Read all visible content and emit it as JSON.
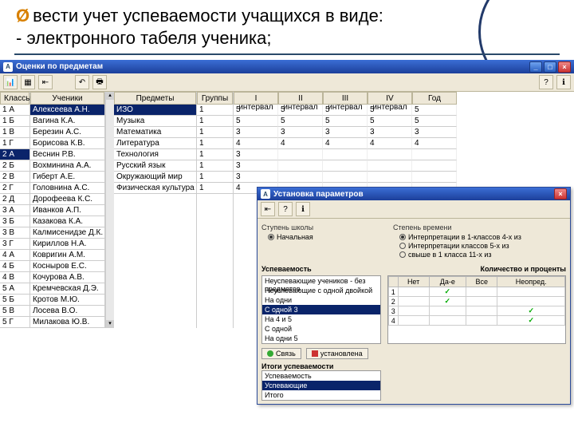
{
  "slide": {
    "line1": "вести учет успеваемости учащихся в виде:",
    "line2": "- электронного табеля ученика;"
  },
  "main_window": {
    "title": "Оценки по предметам",
    "app_icon_letter": "A",
    "toolbar_icons": [
      "chart-icon",
      "grid-icon",
      "exit-icon",
      "",
      "undo-icon",
      "print-icon"
    ],
    "columns": {
      "classes": "Классы",
      "students": "Ученики",
      "subjects": "Предметы",
      "groups": "Группы",
      "interval1": "I интервал",
      "interval2": "II интервал",
      "interval3": "III интервал",
      "interval4": "IV интервал",
      "year": "Год"
    },
    "classes": [
      "1 А",
      "1 Б",
      "1 В",
      "1 Г",
      "2 А",
      "2 Б",
      "2 В",
      "2 Г",
      "2 Д",
      "3 А",
      "3 Б",
      "3 В",
      "3 Г",
      "4 А",
      "4 Б",
      "4 В",
      "5 А",
      "5 Б",
      "5 В",
      "5 Г"
    ],
    "selected_class_index": 4,
    "students": [
      "Алексеева А.Н.",
      "Вагина К.А.",
      "Березин А.С.",
      "Борисова К.В.",
      "Веснин Р.В.",
      "Вохминина А.А.",
      "Гиберт А.Е.",
      "Головнина А.С.",
      "Дорофеева К.С.",
      "Иванков А.П.",
      "Казакова К.А.",
      "Калмисенидзе Д.К.",
      "Кириллов Н.А.",
      "Ковригин А.М.",
      "Косныров Е.С.",
      "Кочурова А.В.",
      "Кремчевская Д.Э.",
      "Кротов М.Ю.",
      "Лосева В.О.",
      "Милакова Ю.В."
    ],
    "selected_student_index": 0,
    "subjects": [
      "ИЗО",
      "Музыка",
      "Математика",
      "Литература",
      "Технология",
      "Русский язык",
      "Окружающий мир",
      "Физическая культура"
    ],
    "selected_subject_index": 0,
    "groups": [
      "1",
      "1",
      "1",
      "1",
      "1",
      "1",
      "1",
      "1"
    ],
    "grades": [
      {
        "i1": "5",
        "i2": "5",
        "i3": "5",
        "i4": "5",
        "y": "5"
      },
      {
        "i1": "5",
        "i2": "5",
        "i3": "5",
        "i4": "5",
        "y": "5"
      },
      {
        "i1": "3",
        "i2": "3",
        "i3": "3",
        "i4": "3",
        "y": "3"
      },
      {
        "i1": "4",
        "i2": "4",
        "i3": "4",
        "i4": "4",
        "y": "4"
      },
      {
        "i1": "3",
        "i2": "",
        "i3": "",
        "i4": "",
        "y": ""
      },
      {
        "i1": "3",
        "i2": "",
        "i3": "",
        "i4": "",
        "y": ""
      },
      {
        "i1": "3",
        "i2": "",
        "i3": "",
        "i4": "",
        "y": ""
      },
      {
        "i1": "4",
        "i2": "",
        "i3": "",
        "i4": "",
        "y": ""
      }
    ]
  },
  "dialog": {
    "title": "Установка параметров",
    "group_school_label": "Ступень школы",
    "school_option": "Начальная",
    "group_time_label": "Степень времени",
    "time_options": [
      "Интерпретации в 1-классов 4-х из",
      "Интерпретации классов 5-х из",
      "свыше в 1 класса 11-х из"
    ],
    "time_selected_index": 0,
    "section1_label": "Успеваемость",
    "section1_right_label": "Количество и проценты",
    "left_items": [
      "Неуспевающие учеников - без предметов",
      "Неуспевающие с одной двойкой",
      "На одни",
      "С одной 3",
      "На 4 и 5",
      "С одной",
      "На одни 5"
    ],
    "left_selected_index": 3,
    "count_headers": [
      "",
      "Нет",
      "Да-е",
      "Все",
      "Неопред."
    ],
    "count_rows": [
      {
        "n": "1",
        "c": 2
      },
      {
        "n": "2",
        "c": 2
      },
      {
        "n": "3",
        "c": 4
      },
      {
        "n": "4",
        "c": 4
      }
    ],
    "btn_link": "Связь",
    "btn_set": "установлена",
    "section2_label": "Итоги успеваемости",
    "bottom_items": [
      "Успеваемость",
      "Успевающие",
      "Итого"
    ],
    "bottom_selected_index": 1
  }
}
